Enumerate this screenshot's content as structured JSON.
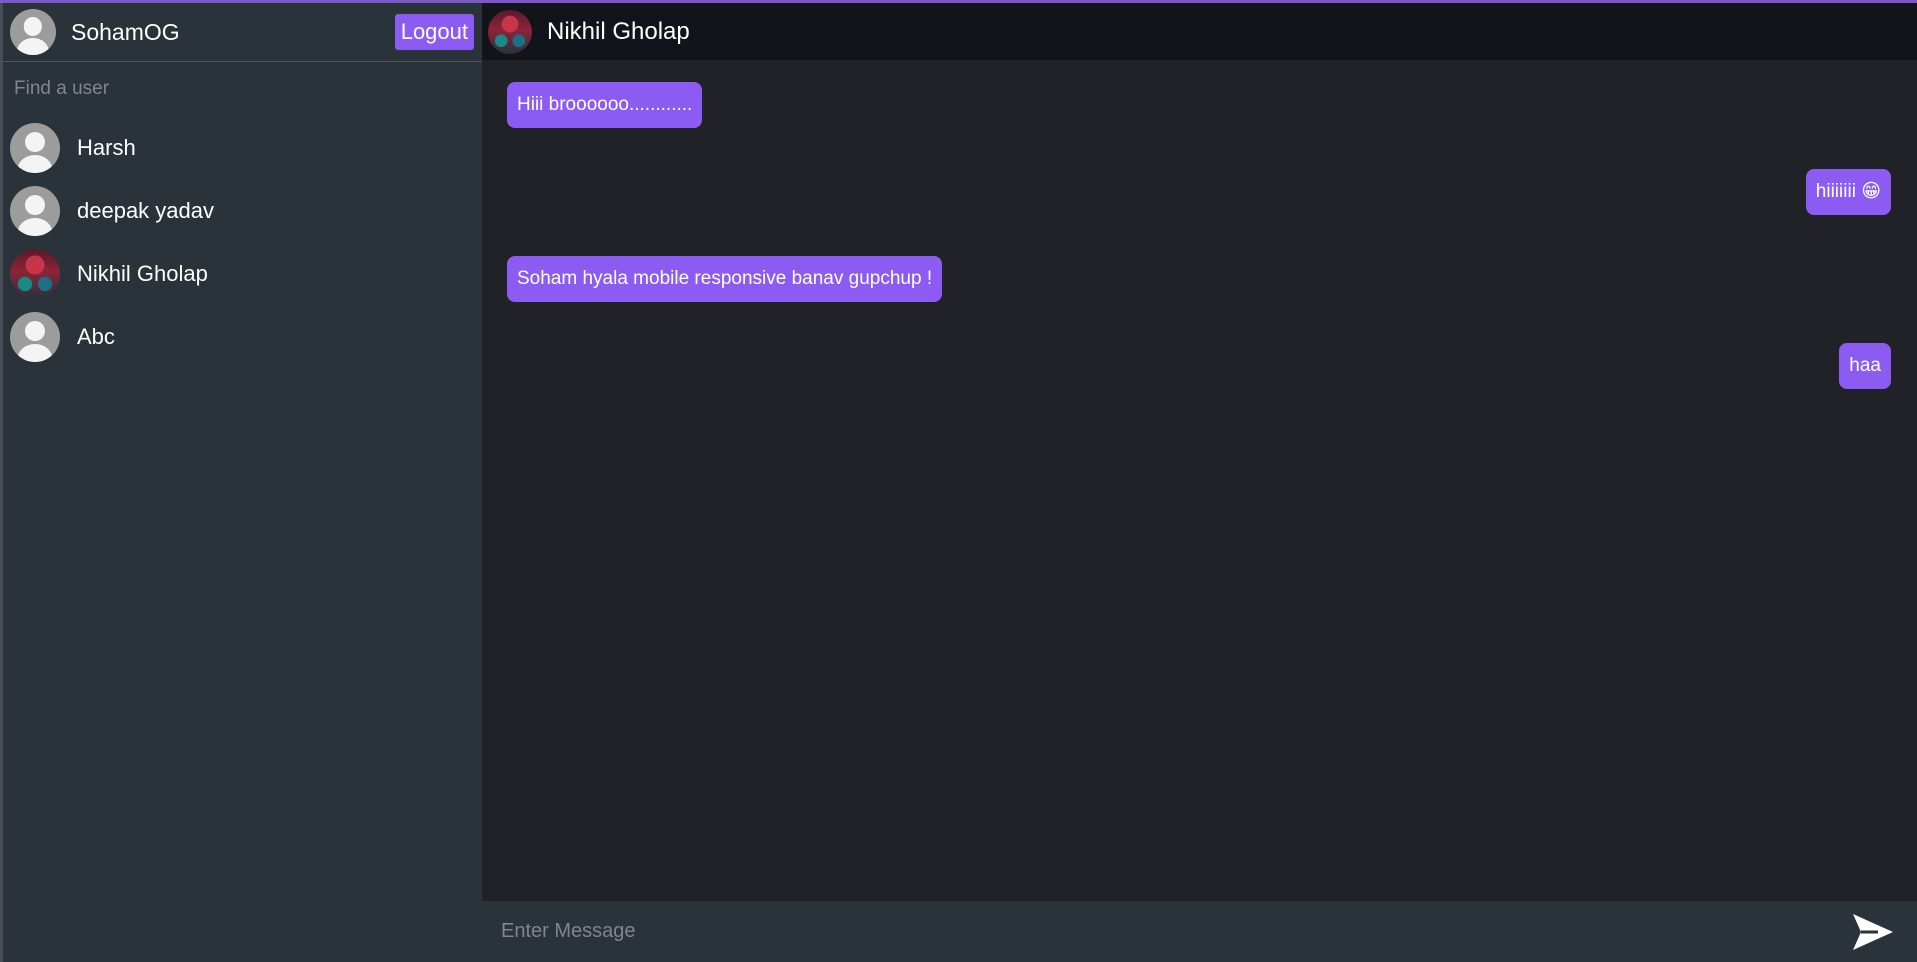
{
  "current_user": {
    "name": "SohamOG",
    "logout_label": "Logout"
  },
  "search": {
    "placeholder": "Find a user"
  },
  "users": [
    {
      "name": "Harsh",
      "avatar": "default-avatar-icon"
    },
    {
      "name": "deepak yadav",
      "avatar": "default-avatar-icon"
    },
    {
      "name": "Nikhil Gholap",
      "avatar": "photo"
    },
    {
      "name": "Abc",
      "avatar": "default-avatar-icon"
    }
  ],
  "chat": {
    "title": "Nikhil Gholap",
    "messages": [
      {
        "text": "Hiii broooooo............",
        "direction": "incoming"
      },
      {
        "text": "hiiiiiii 😁",
        "direction": "outgoing"
      },
      {
        "text": "Soham hyala mobile responsive banav gupchup !",
        "direction": "incoming"
      },
      {
        "text": "haa",
        "direction": "outgoing"
      }
    ],
    "input_placeholder": "Enter Message",
    "send_icon": "send-icon"
  },
  "colors": {
    "accent": "#8c5cf2",
    "sidebar_bg": "#2a323a",
    "chat_bg": "#202227",
    "header_bg": "#13131c"
  }
}
